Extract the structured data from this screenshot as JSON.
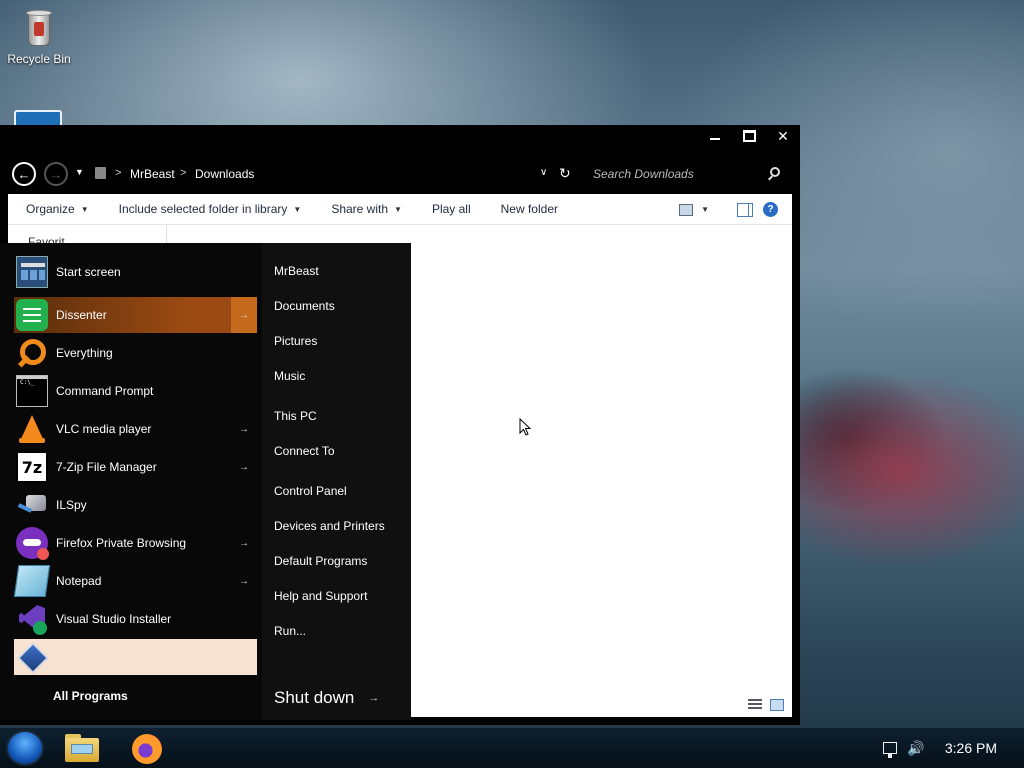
{
  "desktop": {
    "recycle_bin_label": "Recycle Bin"
  },
  "explorer": {
    "breadcrumb": [
      "MrBeast",
      "Downloads"
    ],
    "breadcrumb_separator": ">",
    "search_placeholder": "Search Downloads",
    "toolbar": {
      "organize": "Organize",
      "include_library": "Include selected folder in library",
      "share_with": "Share with",
      "play_all": "Play all",
      "new_folder": "New folder"
    },
    "nav_pane_stub": "Favorit",
    "caption_close": "✕"
  },
  "start_menu": {
    "programs": [
      {
        "label": "Start screen",
        "icon": "start-screen-icon",
        "has_arrow": false
      },
      {
        "label": "Dissenter",
        "icon": "dissenter-icon",
        "has_arrow": true
      },
      {
        "label": "Everything",
        "icon": "everything-icon",
        "has_arrow": false
      },
      {
        "label": "Command Prompt",
        "icon": "command-prompt-icon",
        "has_arrow": false
      },
      {
        "label": "VLC media player",
        "icon": "vlc-icon",
        "has_arrow": true
      },
      {
        "label": "7-Zip File Manager",
        "icon": "7zip-icon",
        "has_arrow": true
      },
      {
        "label": "ILSpy",
        "icon": "ilspy-icon",
        "has_arrow": false
      },
      {
        "label": "Firefox Private Browsing",
        "icon": "firefox-private-icon",
        "has_arrow": true
      },
      {
        "label": "Notepad",
        "icon": "notepad-icon",
        "has_arrow": true
      },
      {
        "label": "Visual Studio Installer",
        "icon": "visual-studio-installer-icon",
        "has_arrow": false
      },
      {
        "label": "",
        "icon": "virtualbox-icon",
        "has_arrow": false
      }
    ],
    "all_programs": "All Programs",
    "places": [
      "MrBeast",
      "Documents",
      "Pictures",
      "Music",
      "This PC",
      "Connect To",
      "Control Panel",
      "Devices and Printers",
      "Default Programs",
      "Help and Support",
      "Run..."
    ],
    "shutdown_label": "Shut down",
    "arrow_glyph": "→",
    "highlight_color": "#9a4a12",
    "selected_color": "#f8e3d3"
  },
  "taskbar": {
    "clock": "3:26 PM",
    "pinned": [
      "windows-explorer-icon",
      "firefox-icon"
    ],
    "seven_zip_glyph": "7z"
  }
}
